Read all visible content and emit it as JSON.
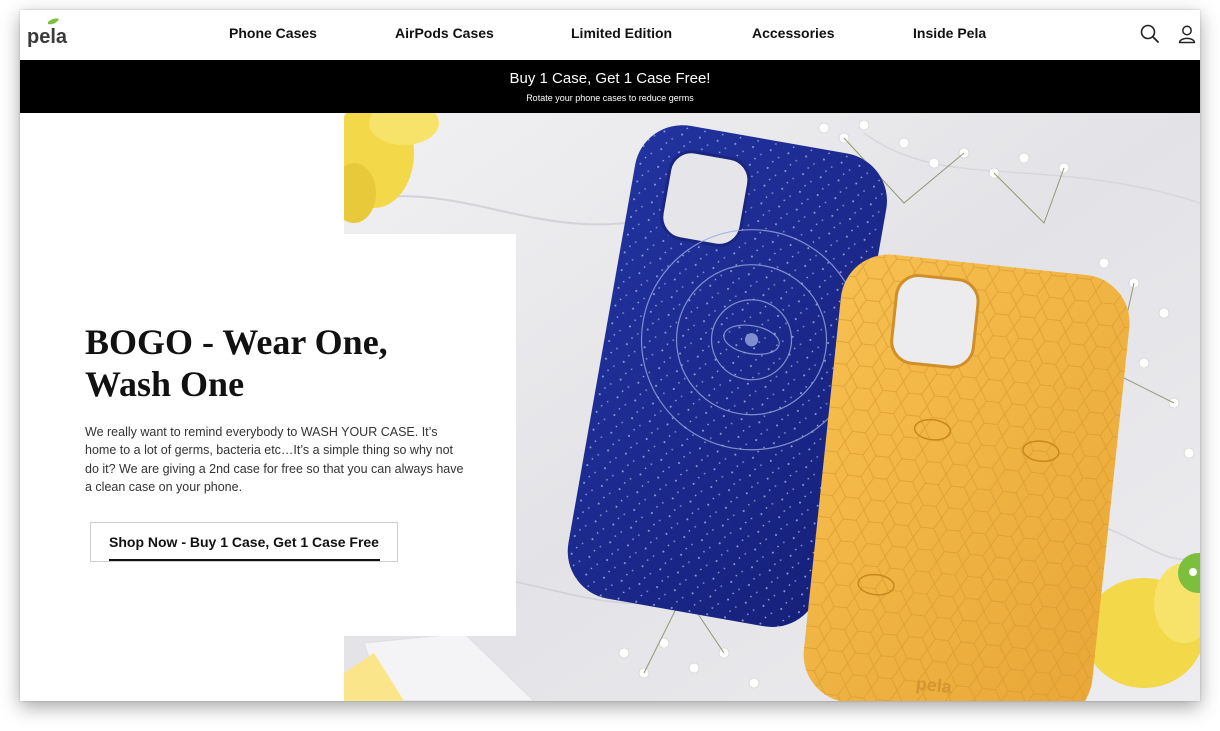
{
  "brand": {
    "logo_text": "pela",
    "logo_color": "#3a3a3a",
    "leaf_color": "#7bbf3c"
  },
  "nav": {
    "items": [
      {
        "label": "Phone Cases"
      },
      {
        "label": "AirPods Cases"
      },
      {
        "label": "Limited Edition"
      },
      {
        "label": "Accessories"
      },
      {
        "label": "Inside Pela"
      }
    ],
    "icons": [
      "search-icon",
      "account-icon"
    ]
  },
  "promo": {
    "title": "Buy 1 Case, Get 1 Case Free!",
    "subtitle": "Rotate your phone cases to reduce germs"
  },
  "hero": {
    "title_line1": "BOGO - Wear One,",
    "title_line2": "Wash One",
    "body": "We really want to remind everybody to WASH YOUR CASE. It’s home to a lot of germs, bacteria etc…It’s a simple thing so why not do it? We are giving a 2nd case for free so that you can always have a clean case on your phone.",
    "cta_label": "Shop Now - Buy 1 Case, Get 1 Case Free",
    "image_description_colors": {
      "blue_case": "#1f2a8a",
      "yellow_case": "#f0b440",
      "marble": "#e9e9ec",
      "flower": "#f5d94a"
    }
  },
  "chat": {
    "icon": "chat-icon",
    "color": "#7bbf3c"
  }
}
